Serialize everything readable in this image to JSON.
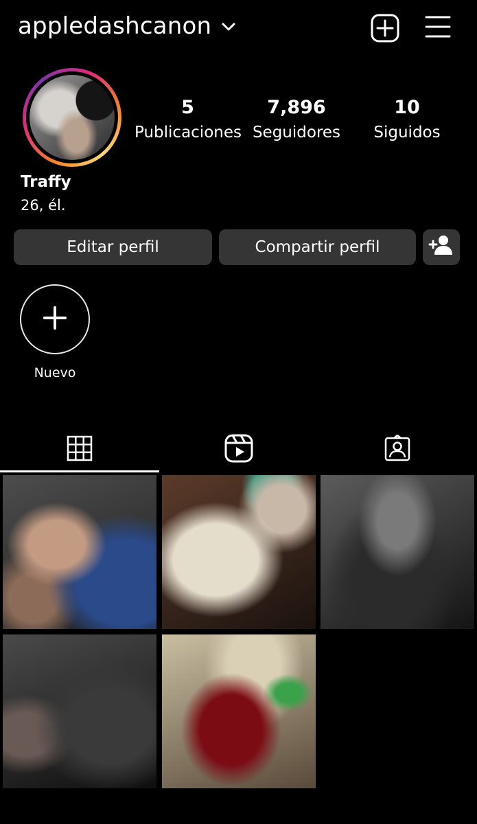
{
  "header": {
    "username": "appledashcanon",
    "icons": [
      "chevron-down-icon",
      "add-post-icon",
      "hamburger-menu-icon"
    ]
  },
  "profile": {
    "stats": [
      {
        "value": "5",
        "label": "Publicaciones"
      },
      {
        "value": "7,896",
        "label": "Seguidores"
      },
      {
        "value": "10",
        "label": "Siguidos"
      }
    ],
    "name": "Traffy",
    "bio": "26, él."
  },
  "actions": {
    "edit_label": "Editar perfil",
    "share_label": "Compartir perfil"
  },
  "highlights": {
    "new_label": "Nuevo"
  },
  "tabs": [
    {
      "icon": "grid-icon",
      "active": true
    },
    {
      "icon": "reels-icon",
      "active": false
    },
    {
      "icon": "tagged-icon",
      "active": false
    }
  ],
  "colors": {
    "background": "#000000",
    "button_bg": "#353535",
    "text": "#ffffff"
  }
}
